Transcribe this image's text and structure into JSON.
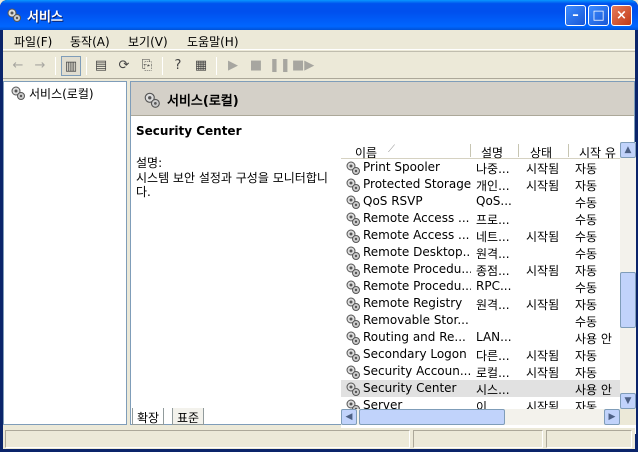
{
  "window": {
    "title": "서비스"
  },
  "menu": [
    "파일(F)",
    "동작(A)",
    "보기(V)",
    "도움말(H)"
  ],
  "toolbar": {
    "icons": [
      "back-arrow-icon",
      "forward-arrow-icon",
      "show-tree-icon",
      "properties-icon",
      "refresh-icon",
      "export-list-icon",
      "help-icon",
      "console-icon",
      "play-icon",
      "stop-icon",
      "pause-icon",
      "restart-icon"
    ]
  },
  "tree": {
    "root_label": "서비스(로컬)"
  },
  "pane": {
    "header_title": "서비스(로컬)",
    "selected_name": "Security Center",
    "desc_label": "설명:",
    "desc_text": "시스템 보안 설정과 구성을 모니터합니다."
  },
  "columns": {
    "name": "이름",
    "desc": "설명",
    "state": "상태",
    "start": "시작 유"
  },
  "services": [
    {
      "name": "Print Spooler",
      "desc": "나중...",
      "state": "시작됨",
      "start": "자동"
    },
    {
      "name": "Protected Storage",
      "desc": "개인...",
      "state": "시작됨",
      "start": "자동"
    },
    {
      "name": "QoS RSVP",
      "desc": "QoS...",
      "state": "",
      "start": "수동"
    },
    {
      "name": "Remote Access ...",
      "desc": "프로...",
      "state": "",
      "start": "수동"
    },
    {
      "name": "Remote Access ...",
      "desc": "네트...",
      "state": "시작됨",
      "start": "수동"
    },
    {
      "name": "Remote Desktop...",
      "desc": "원격...",
      "state": "",
      "start": "수동"
    },
    {
      "name": "Remote Procedu...",
      "desc": "종점...",
      "state": "시작됨",
      "start": "자동"
    },
    {
      "name": "Remote Procedu...",
      "desc": "RPC...",
      "state": "",
      "start": "수동"
    },
    {
      "name": "Remote Registry",
      "desc": "원격...",
      "state": "시작됨",
      "start": "자동"
    },
    {
      "name": "Removable Stor...",
      "desc": "",
      "state": "",
      "start": "수동"
    },
    {
      "name": "Routing and Re...",
      "desc": "LAN...",
      "state": "",
      "start": "사용 안"
    },
    {
      "name": "Secondary Logon",
      "desc": "다른...",
      "state": "시작됨",
      "start": "자동"
    },
    {
      "name": "Security Accoun...",
      "desc": "로컬...",
      "state": "시작됨",
      "start": "자동"
    },
    {
      "name": "Security Center",
      "desc": "시스...",
      "state": "",
      "start": "사용 안",
      "selected": true
    },
    {
      "name": "Server",
      "desc": "이 ...",
      "state": "시작됨",
      "start": "자동"
    }
  ],
  "tabs": [
    "확장",
    "표준"
  ]
}
